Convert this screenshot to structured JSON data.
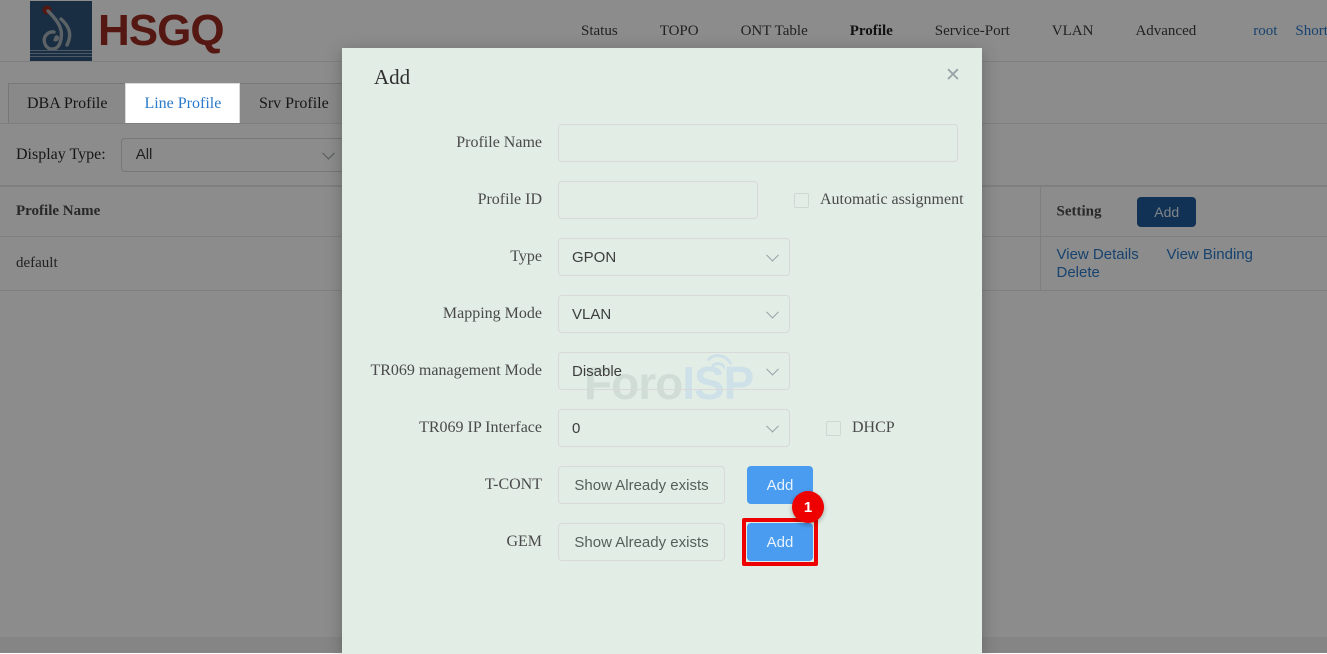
{
  "brand": {
    "logo_text": "HSGQ",
    "logo_square_color": "#2e5479",
    "logo_text_color": "#9c2b20",
    "logo_dot_color": "#9c2b20"
  },
  "topnav": {
    "items": [
      {
        "label": "Status",
        "active": false
      },
      {
        "label": "TOPO",
        "active": false
      },
      {
        "label": "ONT Table",
        "active": false
      },
      {
        "label": "Profile",
        "active": true
      },
      {
        "label": "Service-Port",
        "active": false
      },
      {
        "label": "VLAN",
        "active": false
      },
      {
        "label": "Advanced",
        "active": false
      }
    ],
    "user": "root",
    "shortcut": "Shortcut",
    "link_color": "#2a7ac9"
  },
  "tabs": [
    {
      "label": "DBA Profile",
      "active": false
    },
    {
      "label": "Line Profile",
      "active": true
    },
    {
      "label": "Srv Profile",
      "active": false
    }
  ],
  "filter": {
    "label": "Display Type:",
    "value": "All"
  },
  "table": {
    "headers": {
      "profile_name": "Profile Name",
      "setting": "Setting"
    },
    "header_add_button": "Add",
    "rows": [
      {
        "profile_name": "default",
        "actions": [
          "View Details",
          "View Binding",
          "Delete"
        ]
      }
    ]
  },
  "modal": {
    "title": "Add",
    "close_icon": "close-icon",
    "fields": {
      "profile_name": {
        "label": "Profile Name",
        "value": "",
        "placeholder": ""
      },
      "profile_id": {
        "label": "Profile ID",
        "value": "",
        "placeholder": ""
      },
      "automatic_assignment": {
        "label": "Automatic assignment",
        "checked": false
      },
      "type": {
        "label": "Type",
        "value": "GPON"
      },
      "mapping_mode": {
        "label": "Mapping Mode",
        "value": "VLAN"
      },
      "tr069_management_mode": {
        "label": "TR069 management Mode",
        "value": "Disable"
      },
      "tr069_ip_interface": {
        "label": "TR069 IP Interface",
        "value": "0"
      },
      "dhcp": {
        "label": "DHCP",
        "checked": false
      },
      "tcont": {
        "label": "T-CONT",
        "show_button": "Show Already exists",
        "add_button": "Add"
      },
      "gem": {
        "label": "GEM",
        "show_button": "Show Already exists",
        "add_button": "Add"
      }
    },
    "highlight": {
      "target": "gem-add-button",
      "badge": "1",
      "ring_color": "#ee0000",
      "badge_color": "#ee0000"
    },
    "background_color": "#e2ede6"
  },
  "watermark": {
    "part1": "Foro",
    "part2": "ISP",
    "part1_color": "#c6d4cd",
    "part2_color": "#c4dbea"
  }
}
